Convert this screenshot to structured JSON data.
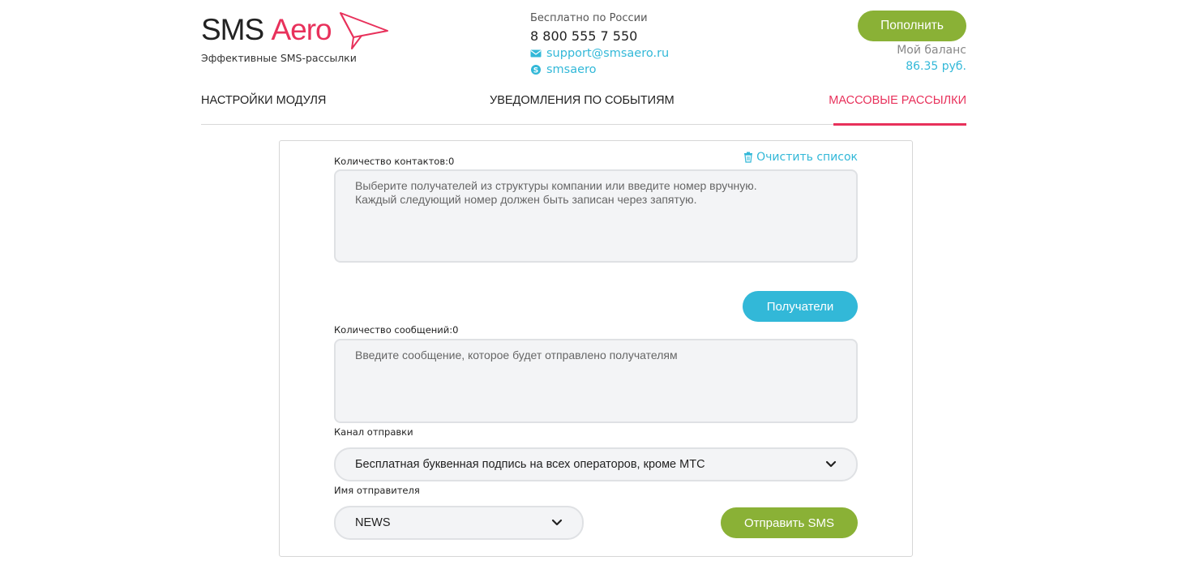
{
  "brand": {
    "name_part1": "SMS",
    "name_part2": "Aero",
    "tagline": "Эффективные SMS-рассылки",
    "accent_color": "#e8315b"
  },
  "contacts": {
    "free_label": "Бесплатно по России",
    "phone": "8 800 555 7 550",
    "email": "support@smsaero.ru",
    "skype": "smsaero",
    "email_icon": "envelope-icon",
    "skype_icon": "skype-icon"
  },
  "account": {
    "topup_label": "Пополнить",
    "balance_label": "Мой баланс",
    "balance_value": "86.35 руб."
  },
  "tabs": [
    {
      "label": "Настройки модуля",
      "active": false
    },
    {
      "label": "Уведомления по событиям",
      "active": false
    },
    {
      "label": "Массовые рассылки",
      "active": true
    }
  ],
  "form": {
    "contacts_count_label": "Количество контактов:0",
    "clear_list_label": "Очистить список",
    "clear_icon": "trash-icon",
    "recipients_placeholder_line1": "Выберите получателей из структуры компании или введите номер вручную.",
    "recipients_placeholder_line2": "Каждый следующий номер должен быть записан через запятую.",
    "recipients_button": "Получатели",
    "messages_count_label": "Количество сообщений:0",
    "message_placeholder": "Введите сообщение, которое будет отправлено получателям",
    "channel_label": "Канал отправки",
    "channel_value": "Бесплатная буквенная подпись на всех операторов, кроме МТС",
    "sender_label": "Имя отправителя",
    "sender_value": "NEWS",
    "send_button": "Отправить SMS"
  },
  "colors": {
    "green": "#8ab136",
    "blue": "#32b8d8",
    "red": "#e8315b",
    "field_bg": "#f3f4f6"
  }
}
